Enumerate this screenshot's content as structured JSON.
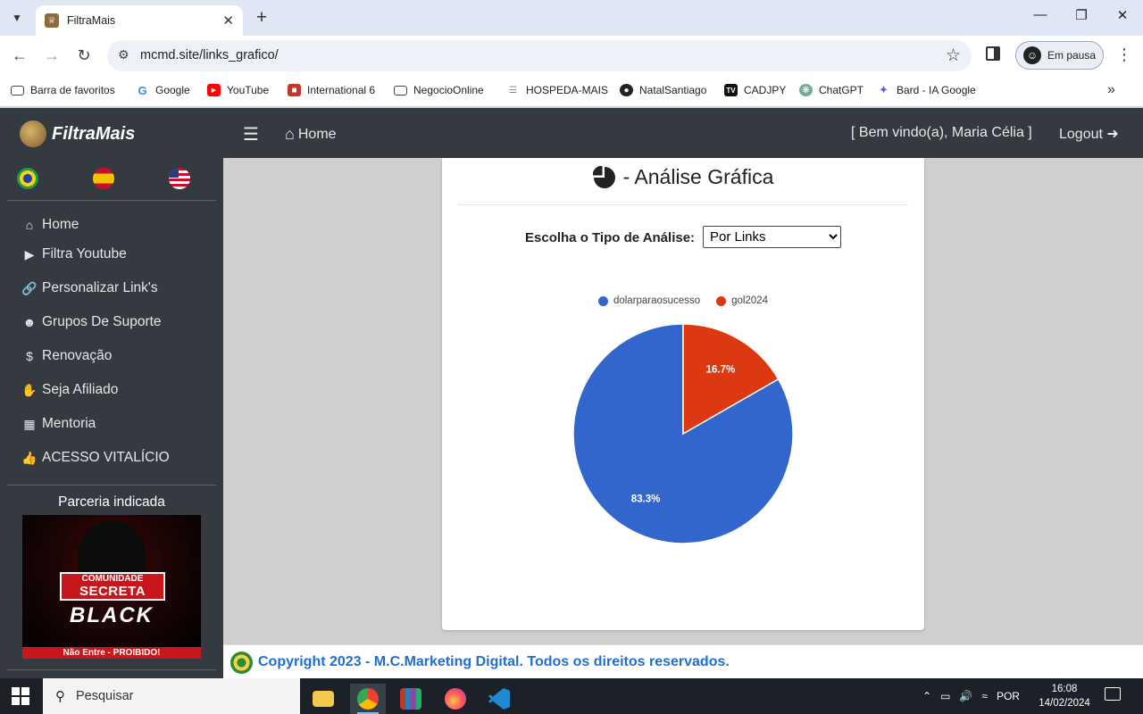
{
  "browser": {
    "tab_title": "FiltraMais",
    "url": "mcmd.site/links_grafico/",
    "profile_label": "Em pausa",
    "bookmarks": [
      {
        "label": "Barra de favoritos",
        "icon": "folder-icon"
      },
      {
        "label": "Google",
        "icon": "google-icon"
      },
      {
        "label": "YouTube",
        "icon": "youtube-icon"
      },
      {
        "label": "International 6",
        "icon": "bookmark-favicon"
      },
      {
        "label": "NegocioOnline",
        "icon": "folder-icon"
      },
      {
        "label": "HOSPEDA-MAIS",
        "icon": "page-icon"
      },
      {
        "label": "NatalSantiago",
        "icon": "github-icon"
      },
      {
        "label": "CADJPY",
        "icon": "tradingview-icon"
      },
      {
        "label": "ChatGPT",
        "icon": "chatgpt-icon"
      },
      {
        "label": "Bard - IA Google",
        "icon": "bard-icon"
      }
    ]
  },
  "header": {
    "logo": "FiltraMais",
    "home": "Home",
    "welcome": "[ Bem vindo(a),  Maria Célia ]",
    "logout": "Logout"
  },
  "sidebar": {
    "items": [
      {
        "label": "Home",
        "icon": "home-icon"
      },
      {
        "label": "Filtra Youtube",
        "icon": "youtube-icon"
      },
      {
        "label": "Personalizar Link's",
        "icon": "link-icon"
      },
      {
        "label": "Grupos De Suporte",
        "icon": "users-icon"
      },
      {
        "label": "Renovação",
        "icon": "money-icon"
      },
      {
        "label": "Seja Afiliado",
        "icon": "handshake-icon"
      },
      {
        "label": "Mentoria",
        "icon": "chalkboard-icon"
      },
      {
        "label": "ACESSO VITALÍCIO",
        "icon": "thumbs-up-icon"
      }
    ],
    "partner_title": "Parceria indicada",
    "banner": {
      "line1": "COMUNIDADE",
      "line2": "SECRETA",
      "line3": "BLACK",
      "strip": "Não Entre - PROIBIDO!"
    }
  },
  "main": {
    "title": "- Análise Gráfica",
    "analysis_label": "Escolha o Tipo de Análise:",
    "analysis_selected": "Por Links"
  },
  "chart_data": {
    "type": "pie",
    "categories": [
      "dolarparaosucesso",
      "gol2024"
    ],
    "values": [
      83.3,
      16.7
    ],
    "labels": [
      "83.3%",
      "16.7%"
    ],
    "colors": [
      "#3366cc",
      "#dc3912"
    ],
    "legend_position": "top"
  },
  "footer": {
    "text": "Copyright 2023 - M.C.Marketing Digital. Todos os direitos reservados."
  },
  "taskbar": {
    "search_placeholder": "Pesquisar",
    "language": "POR",
    "time": "16:08",
    "date": "14/02/2024"
  }
}
